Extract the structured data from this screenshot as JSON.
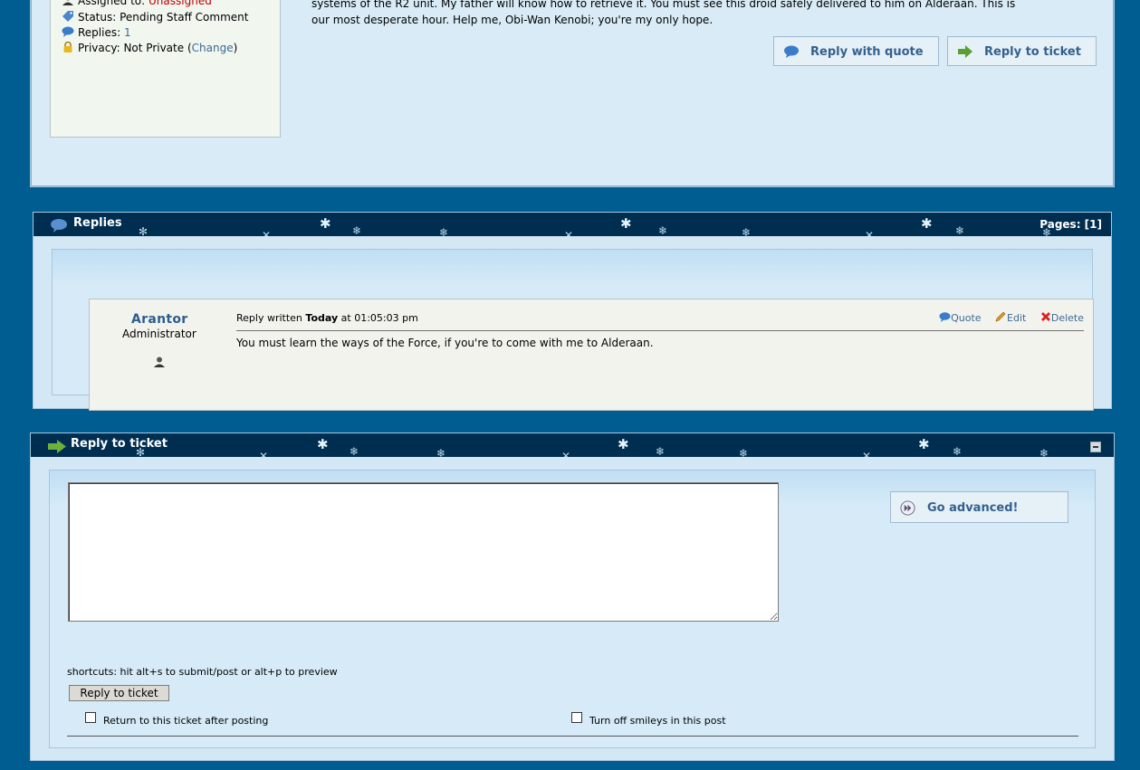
{
  "ticket": {
    "assigned_label": "Assigned to:",
    "assigned_value": "Unassigned",
    "status_label": "Status:",
    "status_value": "Pending Staff Comment",
    "replies_label": "Replies:",
    "replies_value": "1",
    "privacy_label": "Privacy:",
    "privacy_value": "Not Private",
    "privacy_change": "Change",
    "body_line1": "systems of the R2 unit. My father will know how to retrieve it. You must see this droid safely delivered to him on Alderaan. This is",
    "body_line2": "our most desperate hour. Help me, Obi-Wan Kenobi; you're my only hope.",
    "reply_quote_button": "Reply with quote",
    "reply_ticket_button": "Reply to ticket"
  },
  "replies": {
    "header_title": "Replies",
    "pages_label": "Pages: [1]",
    "items": [
      {
        "poster": "Arantor",
        "role": "Administrator",
        "meta_prefix": "Reply written",
        "meta_day": "Today",
        "meta_time": "at 01:05:03 pm",
        "quote_label": "Quote",
        "edit_label": "Edit",
        "delete_label": "Delete",
        "text": "You must learn the ways of the Force, if you're to come with me to Alderaan."
      }
    ]
  },
  "reply_form": {
    "header_title": "Reply to ticket",
    "advanced_button": "Go advanced!",
    "textarea_value": "",
    "shortcuts": "shortcuts: hit alt+s to submit/post or alt+p to preview",
    "submit_label": "Reply to ticket",
    "return_checkbox_label": "Return to this ticket after posting",
    "smileys_checkbox_label": "Turn off smileys in this post"
  },
  "colors": {
    "page_background": "#005d91",
    "header_bar": "#002e50",
    "link": "#3c6a99",
    "unassigned": "#c00000"
  }
}
